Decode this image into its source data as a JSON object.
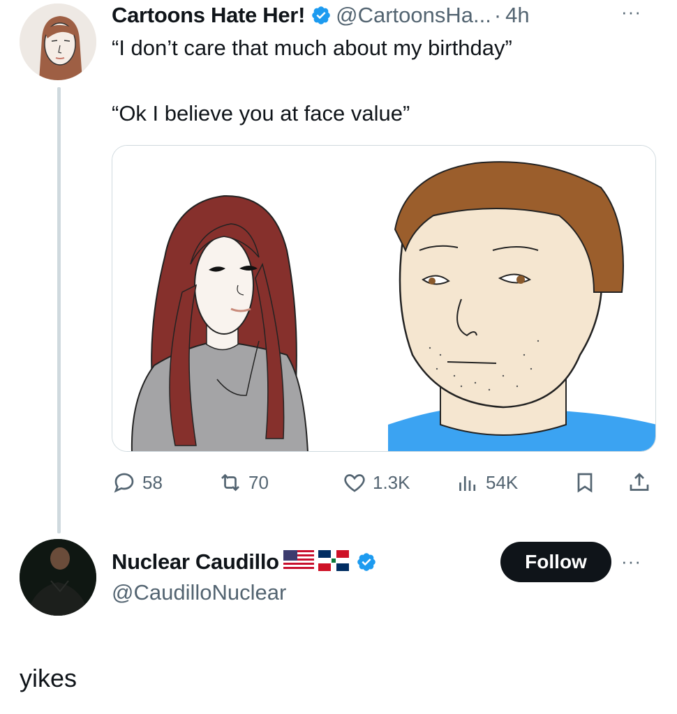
{
  "quoted_tweet": {
    "author_name": "Cartoons Hate Her!",
    "handle": "@CartoonsHa...",
    "separator": "·",
    "time": "4h",
    "more": "···",
    "text_line1": "“I don’t care that much about my birthday”",
    "text_line2": "“Ok I believe you at face value”",
    "stats": {
      "replies": "58",
      "reposts": "70",
      "likes": "1.3K",
      "views": "54K"
    }
  },
  "reply": {
    "author_name": "Nuclear Caudillo",
    "handle": "@CaudilloNuclear",
    "follow_label": "Follow",
    "more": "···",
    "text": "yikes"
  },
  "colors": {
    "verified": "#1d9bf0",
    "secondary_text": "#536471",
    "follow_button": "#0f1419"
  },
  "icons": [
    "verified-badge-icon",
    "reply-icon",
    "repost-icon",
    "like-icon",
    "views-icon",
    "bookmark-icon",
    "share-icon",
    "us-flag-icon",
    "dominican-flag-icon"
  ]
}
